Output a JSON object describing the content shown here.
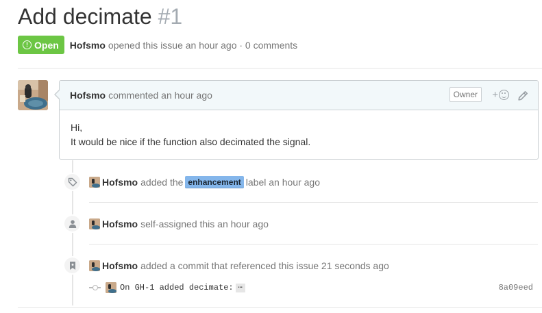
{
  "issue": {
    "title": "Add decimate",
    "number": "#1",
    "state": "Open",
    "author": "Hofsmo",
    "summary": "opened this issue an hour ago · 0 comments"
  },
  "comment": {
    "author": "Hofsmo",
    "when": "commented an hour ago",
    "owner_badge": "Owner",
    "reaction_plus": "+",
    "body_line1": "Hi,",
    "body_line2": "It would be nice if the function also decimated the signal."
  },
  "events": {
    "label_event": {
      "author": "Hofsmo",
      "pre": "added the",
      "label": "enhancement",
      "post": "label an hour ago",
      "label_color": "#84b6eb"
    },
    "assign_event": {
      "author": "Hofsmo",
      "text": "self-assigned this an hour ago"
    },
    "commit_event": {
      "author": "Hofsmo",
      "text": "added a commit that referenced this issue 21 seconds ago",
      "commit_message": "On GH-1 added decimate:",
      "ellipsis": "…",
      "sha": "8a09eed"
    }
  },
  "colors": {
    "open_green": "#6cc644",
    "header_bg": "#f2f8fa"
  }
}
